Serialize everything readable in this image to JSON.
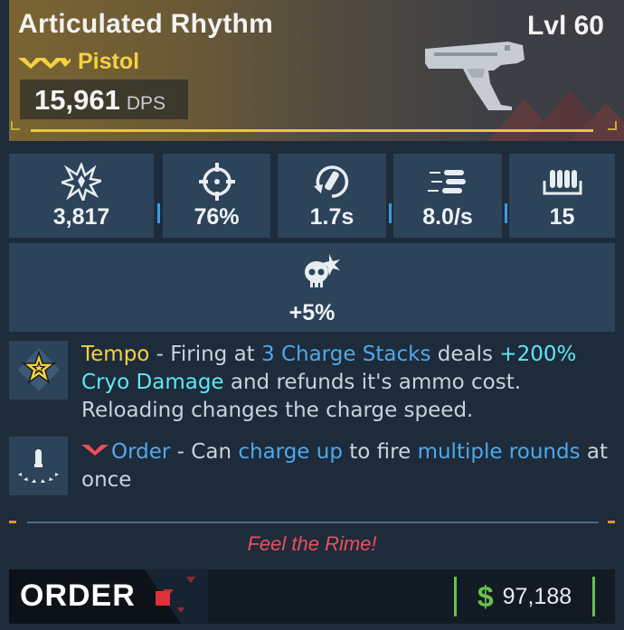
{
  "weapon": {
    "name": "Articulated Rhythm",
    "level": "Lvl 60",
    "type": "Pistol",
    "dps_value": "15,961",
    "dps_unit": "DPS",
    "rarity_icon": "rarity-chevrons-icon",
    "image_icon": "pistol-icon"
  },
  "stats": [
    {
      "icon": "damage-burst-icon",
      "value": "3,817"
    },
    {
      "icon": "crosshair-icon",
      "value": "76%"
    },
    {
      "icon": "reload-icon",
      "value": "1.7s"
    },
    {
      "icon": "fire-rate-icon",
      "value": "8.0/s"
    },
    {
      "icon": "magazine-icon",
      "value": "15"
    }
  ],
  "crit_stat": {
    "icon": "crit-skull-icon",
    "value": "+5%"
  },
  "perks": {
    "tempo": {
      "icon": "star-badge-icon",
      "name": "Tempo",
      "t1": " - Firing at ",
      "k1": "3 Charge Stacks",
      "t2": " deals ",
      "k2": "+200%",
      "k3": "Cryo Damage",
      "t3": " and refunds it's ammo cost. Reloading changes the charge speed."
    },
    "order": {
      "icon": "bullet-spread-icon",
      "name": "Order",
      "t1": " - Can ",
      "k1": "charge up",
      "t2": " to fire ",
      "k2": "multiple rounds",
      "t3": " at once"
    }
  },
  "flavor_text": "Feel the Rime!",
  "footer": {
    "brand": "ORDER",
    "price": "97,188",
    "currency_symbol": "$"
  },
  "colors": {
    "gold": "#f5d240",
    "cyan": "#5ee8f5",
    "blue": "#4fa8e8",
    "flavor_red": "#e8505a",
    "money_green": "#67c24c"
  }
}
